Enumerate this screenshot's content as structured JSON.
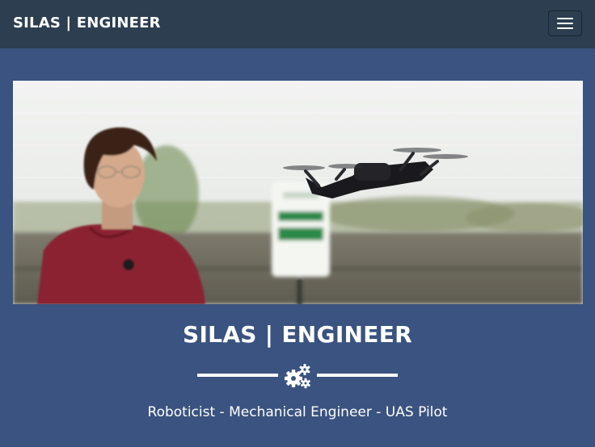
{
  "navbar": {
    "brand": "SILAS | ENGINEER",
    "menu_icon": "hamburger-menu-icon"
  },
  "hero": {
    "image_icon": "drone-photo",
    "title": "SILAS | ENGINEER",
    "divider_icon": "gears-icon",
    "tagline": "Roboticist - Mechanical Engineer - UAS Pilot"
  },
  "colors": {
    "navbar_bg": "#2c3e50",
    "page_bg": "#3a5380",
    "text": "#ffffff"
  }
}
